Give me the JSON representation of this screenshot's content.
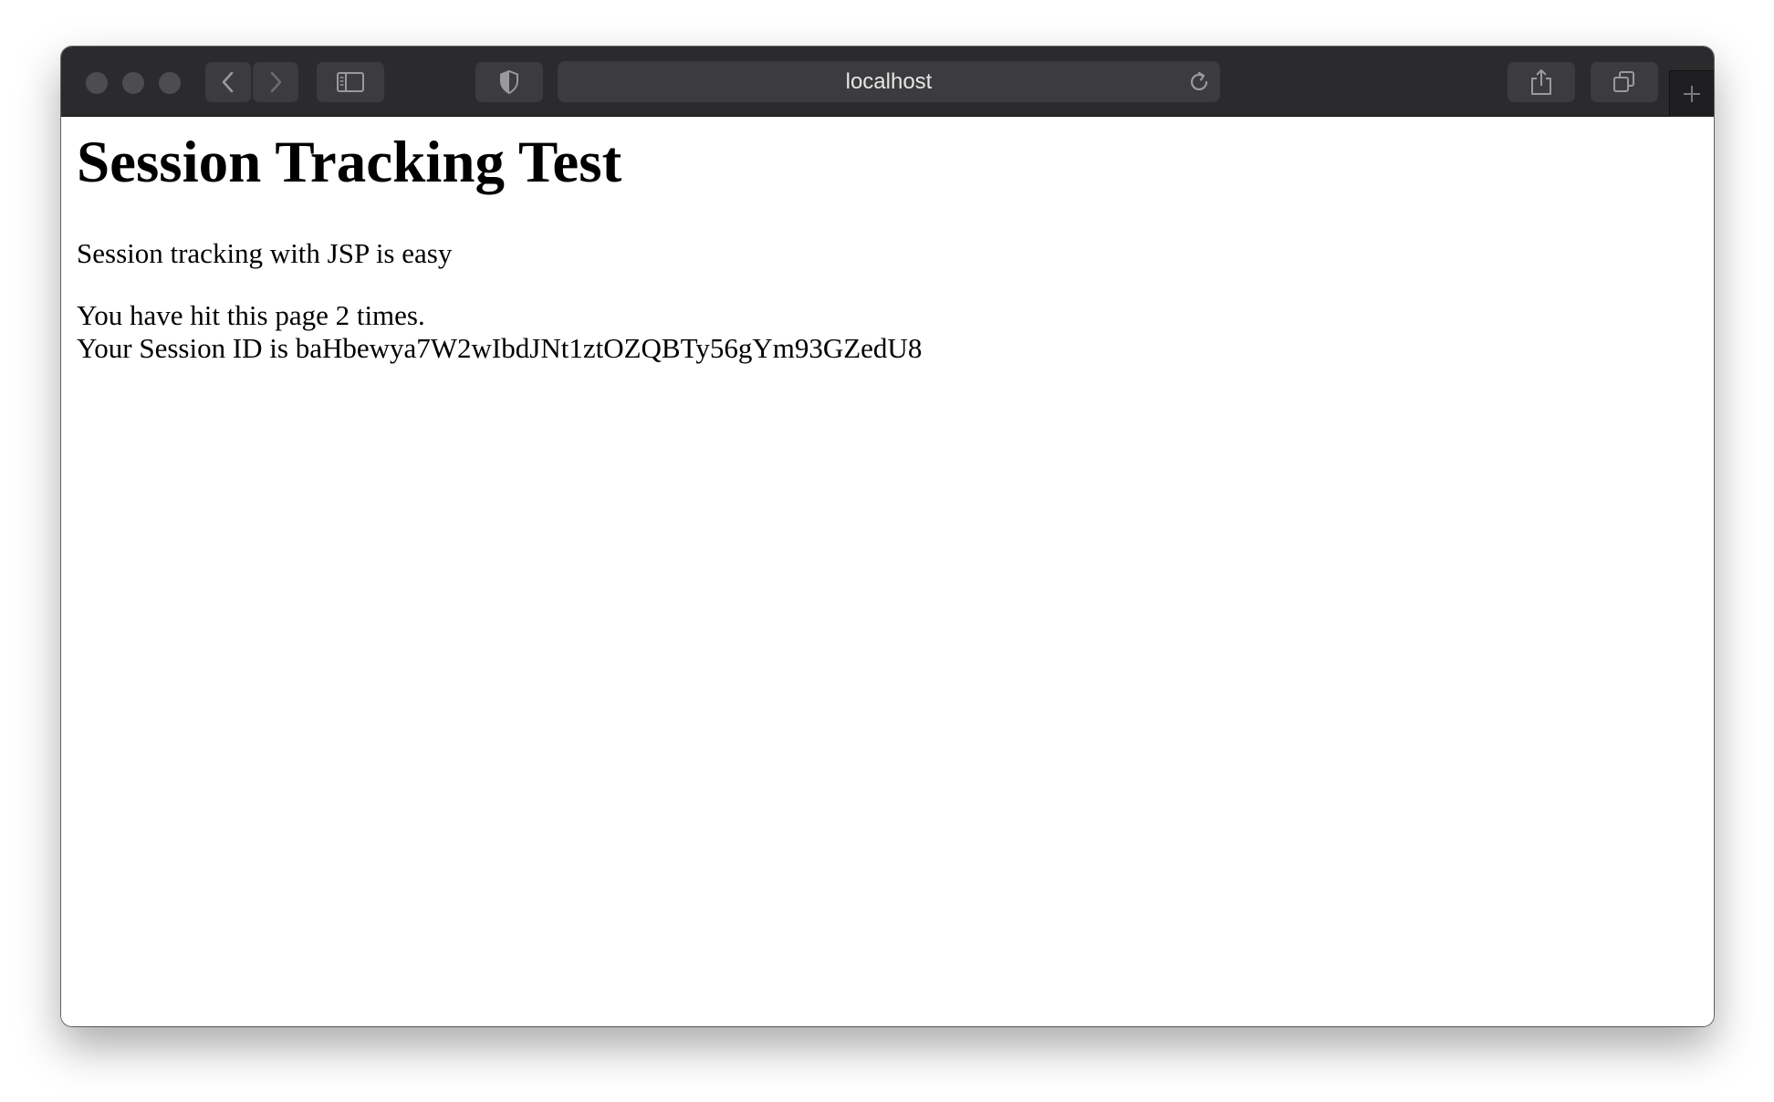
{
  "browser": {
    "address": "localhost",
    "icons": {
      "back": "chevron-left-icon",
      "forward": "chevron-right-icon",
      "sidebar": "sidebar-icon",
      "privacy": "shield-icon",
      "reload": "reload-icon",
      "share": "share-icon",
      "tabs": "tabs-overview-icon",
      "new_tab": "plus-icon"
    }
  },
  "page": {
    "heading": "Session Tracking Test",
    "intro": "Session tracking with JSP is easy",
    "hits_line": "You have hit this page 2 times.",
    "session_line": "Your Session ID is baHbewya7W2wIbdJNt1ztOZQBTy56gYm93GZedU8"
  }
}
